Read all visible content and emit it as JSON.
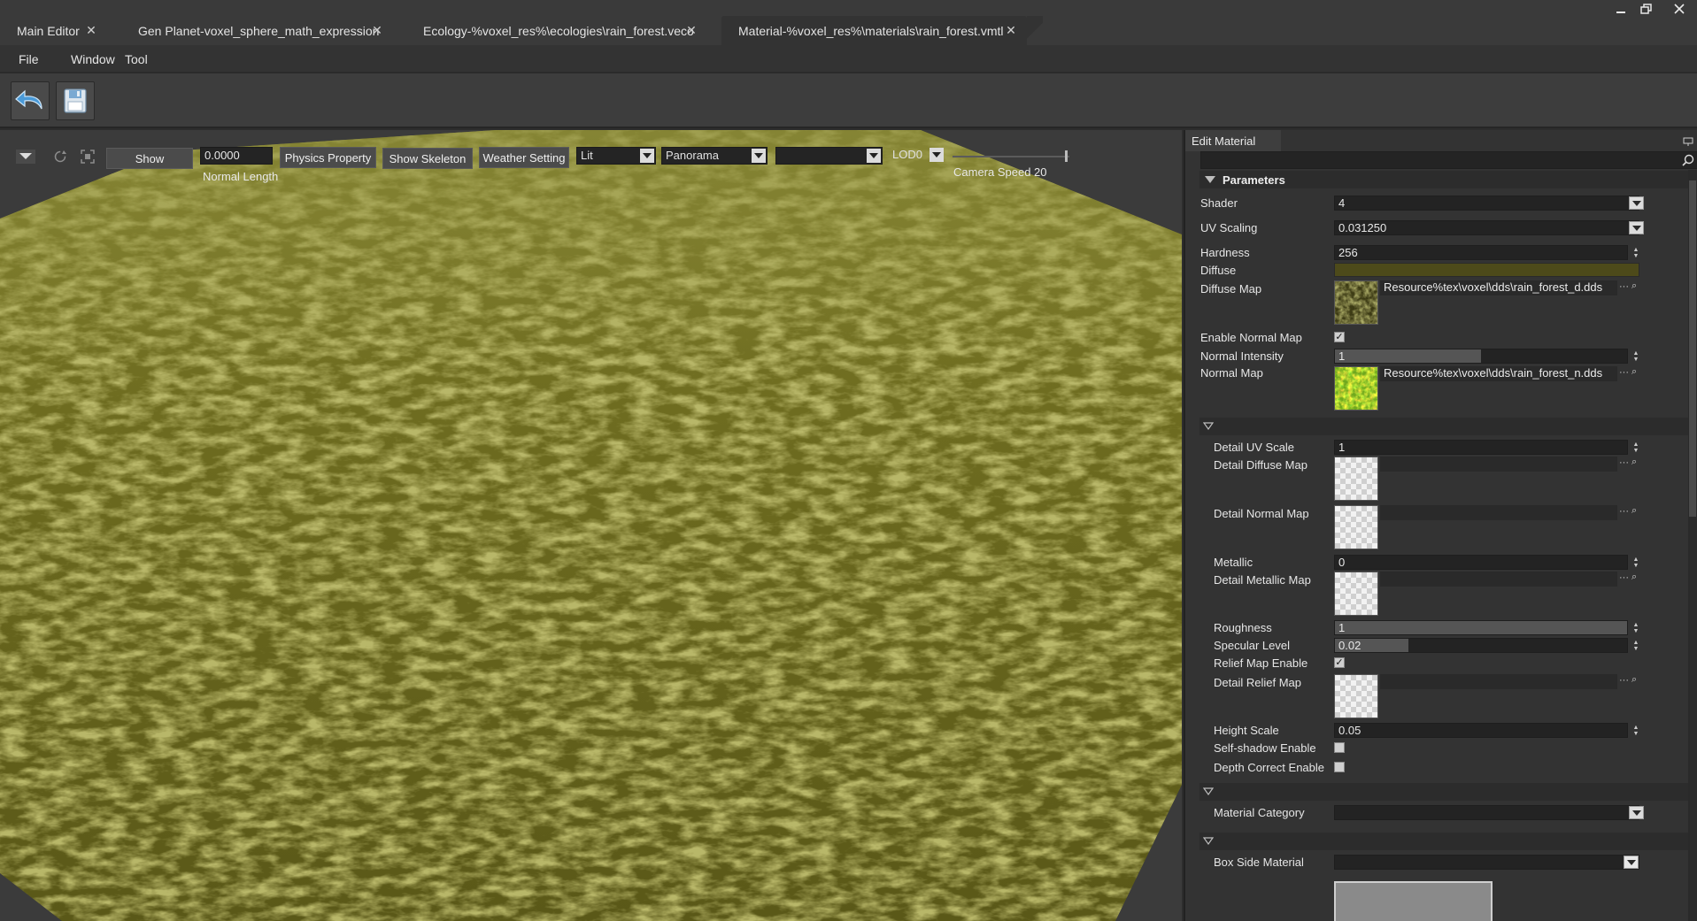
{
  "tabs": [
    {
      "label": "Main Editor"
    },
    {
      "label": "Gen Planet-voxel_sphere_math_expression"
    },
    {
      "label": "Ecology-%voxel_res%\\ecologies\\rain_forest.veco"
    },
    {
      "label": "Material-%voxel_res%\\materials\\rain_forest.vmtl"
    }
  ],
  "menu": {
    "file": "File",
    "window": "Window",
    "tool": "Tool"
  },
  "viewport": {
    "show_button": "Show",
    "normal_length_value": "0.0000",
    "normal_length_label": "Normal Length",
    "physics_button": "Physics Property",
    "skeleton_button": "Show Skeleton",
    "weather_button": "Weather Setting",
    "lit_combo": "Lit",
    "panorama_combo": "Panorama",
    "empty_combo": "",
    "lod_combo": "LOD0",
    "camera_speed_label": "Camera Speed 20",
    "terrain_colors": {
      "base": "#6b6a1e",
      "light": "#8d8a2c",
      "dark": "#3e3c14"
    }
  },
  "panel": {
    "title": "Edit Material",
    "search_placeholder": "",
    "parameters_header": "Parameters",
    "shader_label": "Shader",
    "shader_value": "4",
    "uv_scaling_label": "UV Scaling",
    "uv_scaling_value": "0.031250",
    "hardness_label": "Hardness",
    "hardness_value": "256",
    "diffuse_label": "Diffuse",
    "diffuse_color": "#4d4a1a",
    "diffuse_map_label": "Diffuse Map",
    "diffuse_map_path": "Resource%tex\\voxel\\dds\\rain_forest_d.dds",
    "enable_normal_map_label": "Enable Normal Map",
    "enable_normal_map": true,
    "normal_intensity_label": "Normal Intensity",
    "normal_intensity_value": "1",
    "normal_intensity_fill": 0.5,
    "normal_map_label": "Normal Map",
    "normal_map_path": "Resource%tex\\voxel\\dds\\rain_forest_n.dds",
    "detail_uv_scale_label": "Detail UV Scale",
    "detail_uv_scale_value": "1",
    "detail_diffuse_map_label": "Detail Diffuse Map",
    "detail_normal_map_label": "Detail Normal Map",
    "metallic_label": "Metallic",
    "metallic_value": "0",
    "detail_metallic_map_label": "Detail Metallic Map",
    "roughness_label": "Roughness",
    "roughness_value": "1",
    "roughness_fill": 1.0,
    "specular_level_label": "Specular Level",
    "specular_level_value": "0.02",
    "specular_level_fill": 0.25,
    "relief_map_enable_label": "Relief Map Enable",
    "relief_map_enable": true,
    "detail_relief_map_label": "Detail Relief Map",
    "height_scale_label": "Height Scale",
    "height_scale_value": "0.05",
    "self_shadow_enable_label": "Self-shadow Enable",
    "self_shadow_enable": false,
    "depth_correct_enable_label": "Depth Correct Enable",
    "depth_correct_enable": false,
    "material_category_label": "Material Category",
    "material_category_value": "",
    "box_side_material_label": "Box Side Material",
    "box_side_material_value": ""
  }
}
